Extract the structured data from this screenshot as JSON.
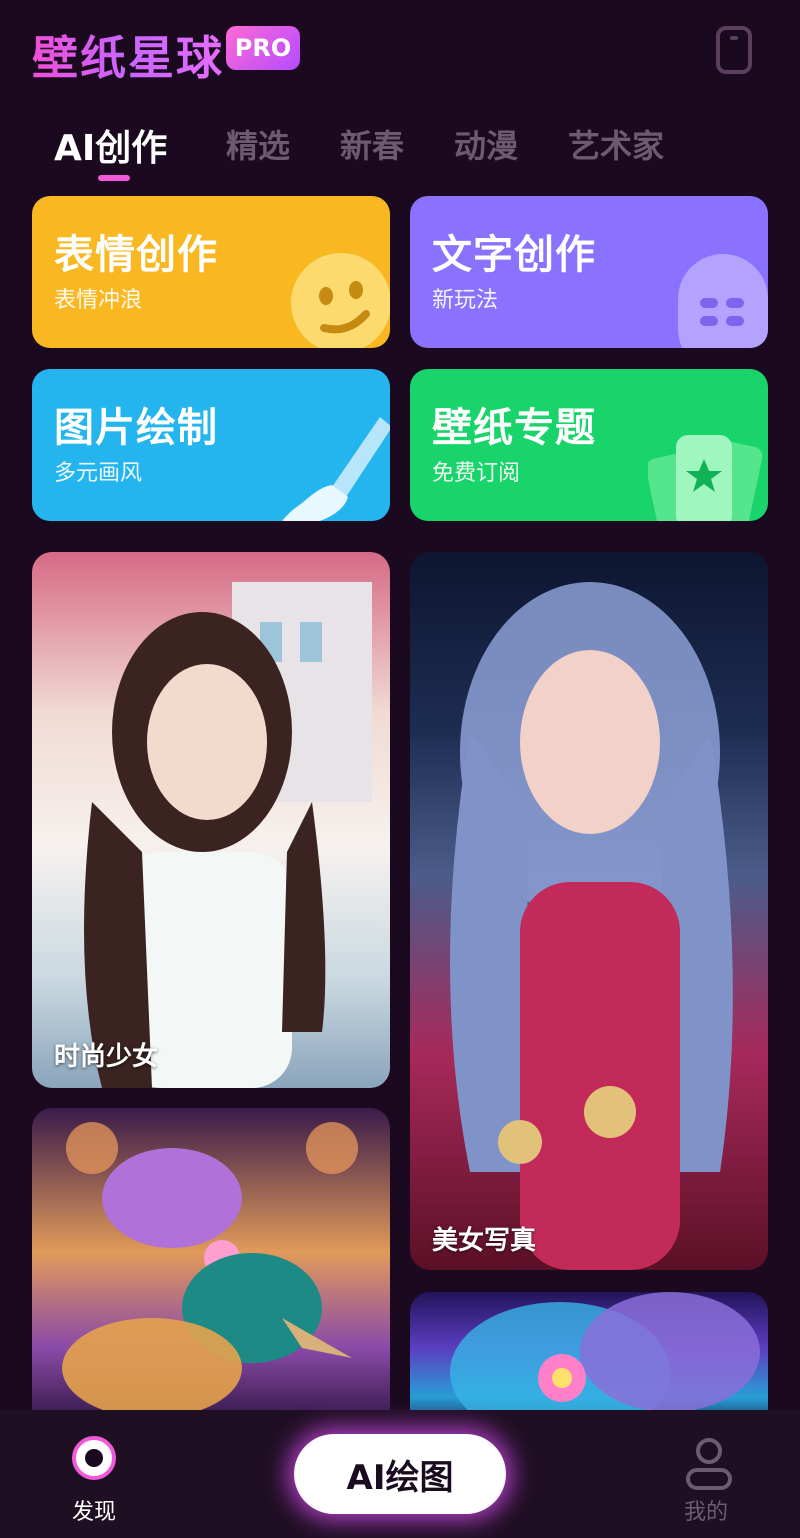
{
  "header": {
    "app_title": "壁纸星球",
    "badge": "PRO",
    "right_icon": "phone-icon"
  },
  "tabs": [
    {
      "label": "AI创作",
      "active": true
    },
    {
      "label": "精选",
      "active": false
    },
    {
      "label": "新春",
      "active": false
    },
    {
      "label": "动漫",
      "active": false
    },
    {
      "label": "艺术家",
      "active": false
    }
  ],
  "features": [
    {
      "title": "表情创作",
      "subtitle": "表情冲浪",
      "color": "#f9b722",
      "icon": "emoji-face-icon"
    },
    {
      "title": "文字创作",
      "subtitle": "新玩法",
      "color": "#8a72ff",
      "icon": "microphone-icon"
    },
    {
      "title": "图片绘制",
      "subtitle": "多元画风",
      "color": "#25b5ee",
      "icon": "paintbrush-icon"
    },
    {
      "title": "壁纸专题",
      "subtitle": "免费订阅",
      "color": "#19d46b",
      "icon": "wallpaper-cards-icon"
    }
  ],
  "gallery": [
    {
      "caption": "时尚少女"
    },
    {
      "caption": "美女写真"
    },
    {
      "caption": ""
    },
    {
      "caption": ""
    }
  ],
  "bottom_nav": {
    "discover_label": "发现",
    "ai_button_label": "AI绘图",
    "me_label": "我的",
    "active_color": "#f05ad8",
    "inactive_color": "#6d5c71"
  }
}
